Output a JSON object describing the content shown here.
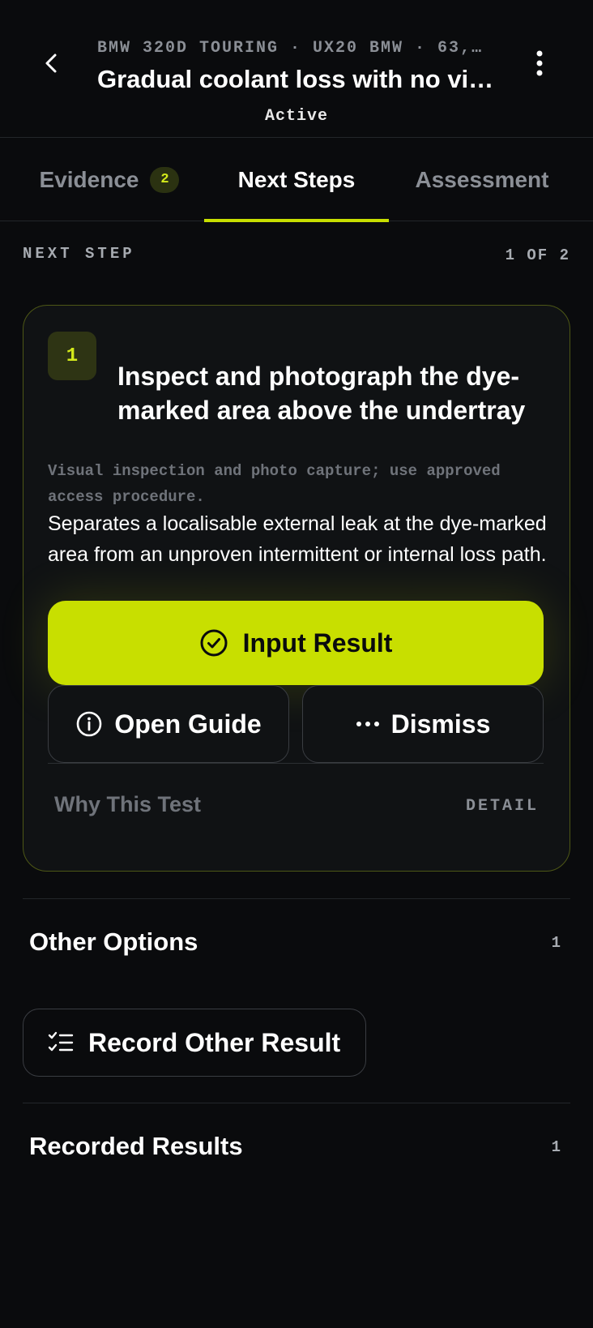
{
  "header": {
    "subtitle": "BMW 320D TOURING · UX20 BMW · 63,…",
    "title": "Gradual coolant loss with no vi…",
    "status": "Active"
  },
  "tabs": [
    {
      "label": "Evidence",
      "badge": "2",
      "active": false
    },
    {
      "label": "Next Steps",
      "active": true
    },
    {
      "label": "Assessment",
      "active": false
    }
  ],
  "next_step": {
    "section_label": "NEXT STEP",
    "count": "1 OF 2",
    "number": "1",
    "title": "Inspect and photograph the dye-marked area above the undertray",
    "method": "Visual inspection and photo capture; use approved access procedure.",
    "description": "Separates a localisable external leak at the dye-marked area from an unproven intermittent or internal loss path.",
    "primary_button": "Input Result",
    "guide_button": "Open Guide",
    "dismiss_button": "Dismiss",
    "why_label": "Why This Test",
    "detail_label": "DETAIL"
  },
  "other_options": {
    "title": "Other Options",
    "count": "1",
    "record_button": "Record Other Result"
  },
  "recorded_results": {
    "title": "Recorded Results",
    "count": "1"
  },
  "colors": {
    "accent": "#c8df00",
    "background": "#0a0b0d",
    "card": "#101214"
  },
  "icons": {
    "back": "chevron-left-icon",
    "more": "more-vertical-icon",
    "input_result": "check-circle-icon",
    "guide": "info-circle-icon",
    "dismiss": "more-horizontal-icon",
    "record": "checklist-icon"
  }
}
